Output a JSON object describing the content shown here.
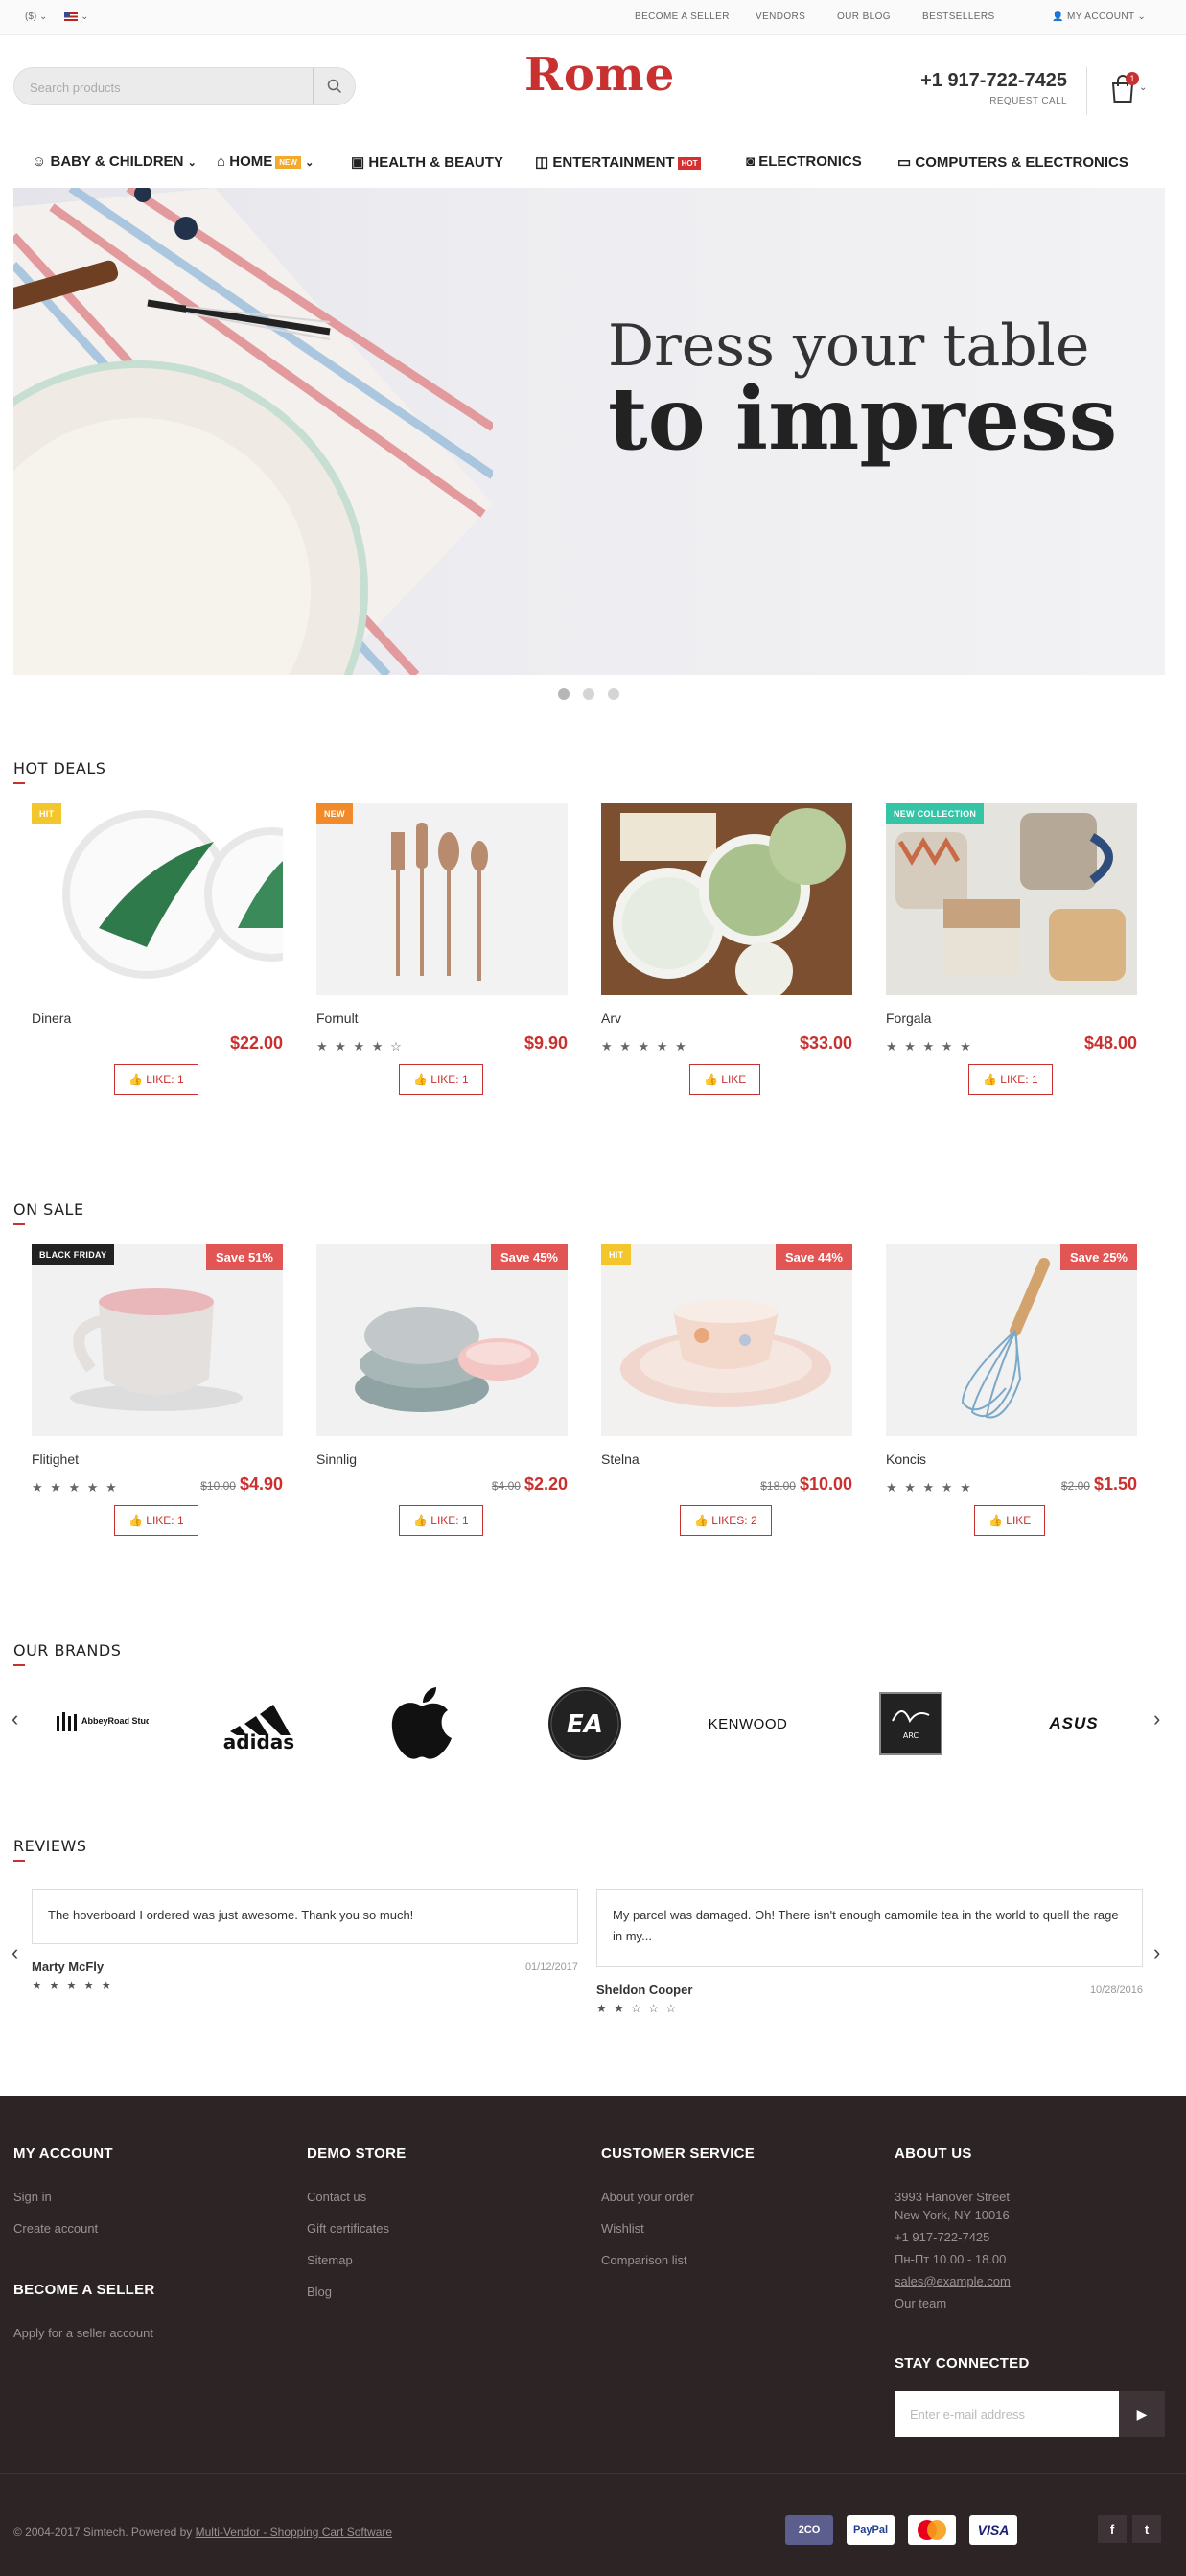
{
  "topbar": {
    "currency": "($)",
    "links": [
      "BECOME A SELLER",
      "VENDORS",
      "OUR BLOG",
      "BESTSELLERS"
    ],
    "account": "MY ACCOUNT"
  },
  "header": {
    "search_placeholder": "Search products",
    "logo": "Rome",
    "phone": "+1 917-722-7425",
    "request_call": "REQUEST CALL",
    "cart_count": "1"
  },
  "menu": {
    "items": [
      "BABY & CHILDREN",
      "HOME",
      "HEALTH & BEAUTY",
      "ENTERTAINMENT",
      "ELECTRONICS",
      "COMPUTERS & ELECTRONICS"
    ],
    "home_tag": "NEW",
    "entertainment_tag": "HOT"
  },
  "hero": {
    "line1": "Dress your table",
    "line2": "to impress"
  },
  "hot_deals": {
    "title": "HOT DEALS",
    "products": [
      {
        "badge": "HIT",
        "name": "Dinera",
        "price": "$22.00",
        "like": "LIKE: 1",
        "stars": "",
        "badge_color": "#f3c62b"
      },
      {
        "badge": "NEW",
        "name": "Fornult",
        "price": "$9.90",
        "like": "LIKE: 1",
        "stars": "★ ★ ★ ★ ☆",
        "badge_color": "#f08a2a"
      },
      {
        "badge": "",
        "name": "Arv",
        "price": "$33.00",
        "like": "LIKE",
        "stars": "★ ★ ★ ★ ★",
        "badge_color": ""
      },
      {
        "badge": "NEW COLLECTION",
        "name": "Forgala",
        "price": "$48.00",
        "like": "LIKE: 1",
        "stars": "★ ★ ★ ★ ★",
        "badge_color": "#35c4a6"
      }
    ]
  },
  "on_sale": {
    "title": "ON SALE",
    "products": [
      {
        "badge": "BLACK FRIDAY",
        "save": "Save 51%",
        "name": "Flitighet",
        "old": "$10.00",
        "price": "$4.90",
        "like": "LIKE: 1",
        "stars": "★ ★ ★ ★ ★",
        "badge_color": "#222"
      },
      {
        "badge": "",
        "save": "Save 45%",
        "name": "Sinnlig",
        "old": "$4.00",
        "price": "$2.20",
        "like": "LIKE: 1",
        "stars": "",
        "badge_color": ""
      },
      {
        "badge": "HIT",
        "save": "Save 44%",
        "name": "Stelna",
        "old": "$18.00",
        "price": "$10.00",
        "like": "LIKES: 2",
        "stars": "",
        "badge_color": "#f3c62b"
      },
      {
        "badge": "",
        "save": "Save 25%",
        "name": "Koncis",
        "old": "$2.00",
        "price": "$1.50",
        "like": "LIKE",
        "stars": "★ ★ ★ ★ ★",
        "badge_color": ""
      }
    ]
  },
  "brands": {
    "title": "OUR BRANDS",
    "items": [
      "AbbeyRoad Studios",
      "adidas",
      "apple",
      "EA",
      "KENWOOD",
      "ARC",
      "ASUS"
    ]
  },
  "reviews": {
    "title": "REVIEWS",
    "items": [
      {
        "text": "The hoverboard I ordered was just awesome. Thank you so much!",
        "name": "Marty McFly",
        "date": "01/12/2017",
        "stars": "★ ★ ★ ★ ★"
      },
      {
        "text": "My parcel was damaged. Oh! There isn't enough camomile tea in the world to quell the rage in my...",
        "name": "Sheldon Cooper",
        "date": "10/28/2016",
        "stars": "★ ★ ☆ ☆ ☆"
      }
    ]
  },
  "footer": {
    "my_account": {
      "title": "MY ACCOUNT",
      "links": [
        "Sign in",
        "Create account"
      ]
    },
    "become_seller": {
      "title": "BECOME A SELLER",
      "links": [
        "Apply for a seller account"
      ]
    },
    "demo_store": {
      "title": "DEMO STORE",
      "links": [
        "Contact us",
        "Gift certificates",
        "Sitemap",
        "Blog"
      ]
    },
    "customer_service": {
      "title": "CUSTOMER SERVICE",
      "links": [
        "About your order",
        "Wishlist",
        "Comparison list"
      ]
    },
    "about": {
      "title": "ABOUT US",
      "lines": [
        "3993 Hanover Street",
        "New York, NY 10016",
        "+1 917-722-7425",
        "Пн-Пт 10.00 - 18.00",
        "sales@example.com",
        "Our team"
      ]
    },
    "stay_connected": {
      "title": "STAY CONNECTED",
      "placeholder": "Enter e-mail address"
    },
    "copyright": "© 2004-2017 Simtech.  Powered by",
    "powered_link": "Multi-Vendor - Shopping Cart Software",
    "payments": [
      "2CO",
      "PayPal",
      "MasterCard",
      "VISA"
    ],
    "social": [
      "f",
      "t"
    ]
  }
}
